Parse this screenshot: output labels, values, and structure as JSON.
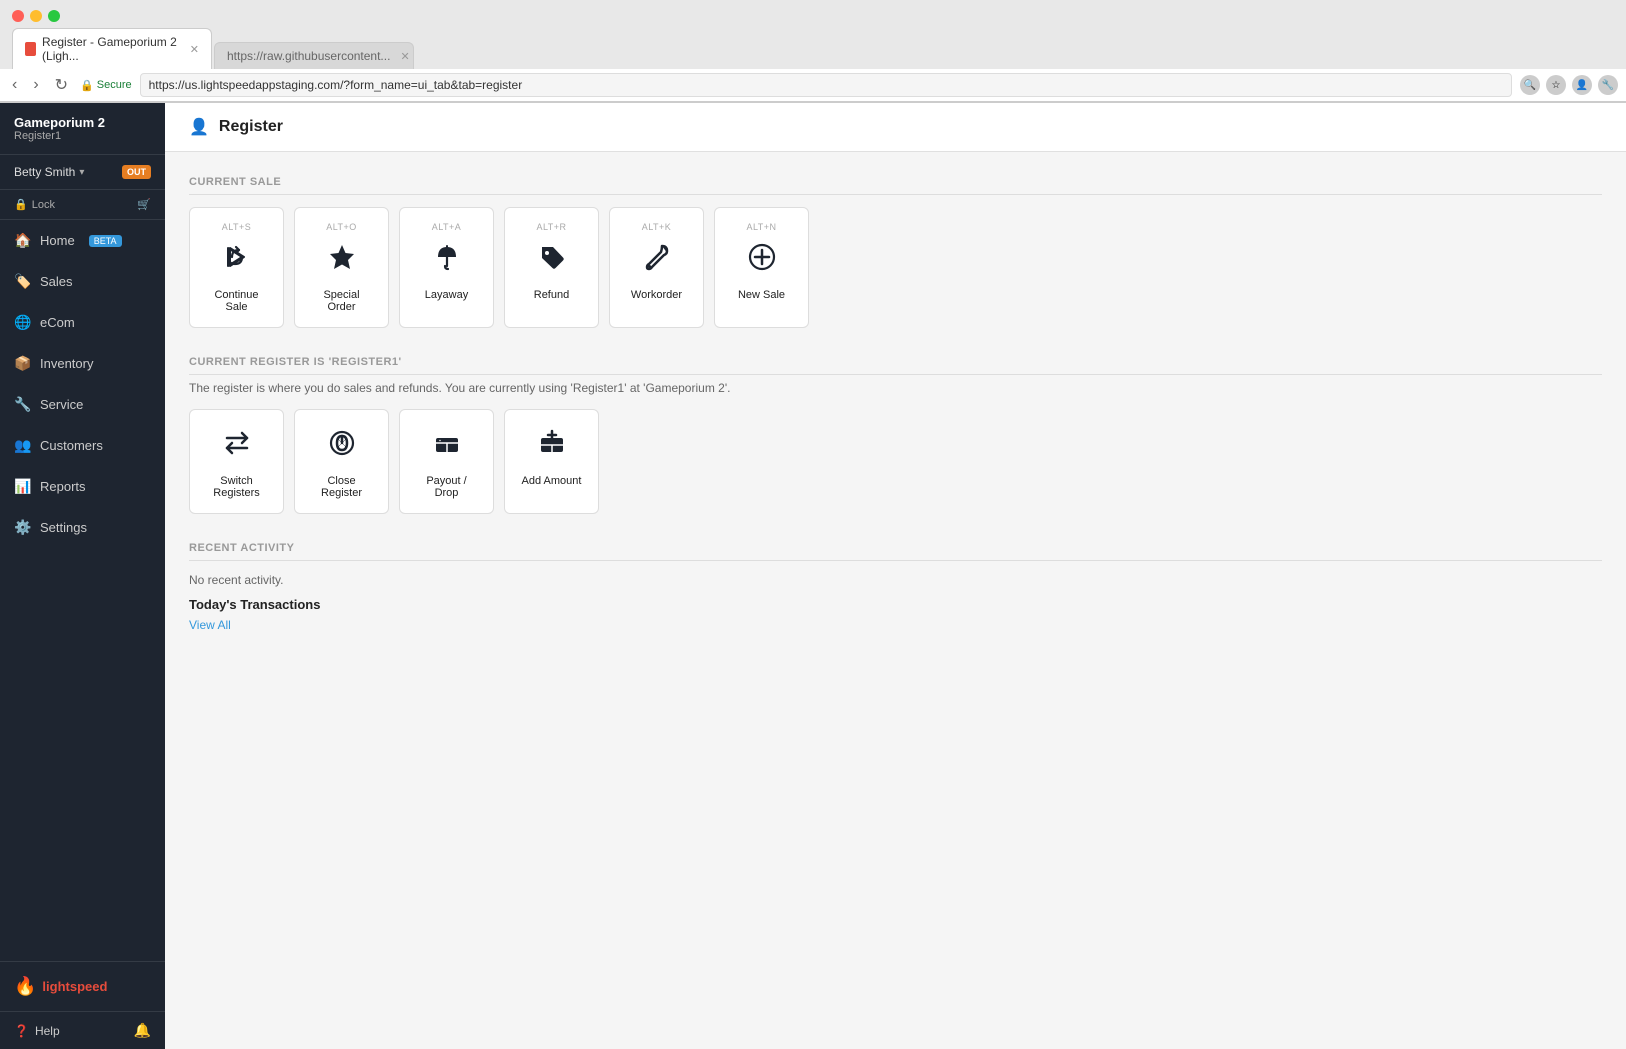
{
  "browser": {
    "tabs": [
      {
        "id": "tab1",
        "label": "Register - Gameporium 2 (Ligh...",
        "active": true,
        "favicon": true
      },
      {
        "id": "tab2",
        "label": "https://raw.githubusercontent...",
        "active": false,
        "favicon": false
      }
    ],
    "url": "https://us.lightspeedappstaging.com/?form_name=ui_tab&tab=register",
    "secure_label": "Secure"
  },
  "sidebar": {
    "store_name": "Gameporium 2",
    "register": "Register1",
    "user_name": "Betty Smith",
    "user_badge": "OUT",
    "quick_actions": [
      {
        "id": "lock",
        "label": "Lock",
        "icon": "🔒"
      },
      {
        "id": "cart",
        "icon": "🛒"
      }
    ],
    "nav_items": [
      {
        "id": "home",
        "label": "Home",
        "icon": "home",
        "badge": "BETA"
      },
      {
        "id": "sales",
        "label": "Sales",
        "icon": "tag"
      },
      {
        "id": "ecom",
        "label": "eCom",
        "icon": "globe"
      },
      {
        "id": "inventory",
        "label": "Inventory",
        "icon": "box"
      },
      {
        "id": "service",
        "label": "Service",
        "icon": "wrench"
      },
      {
        "id": "customers",
        "label": "Customers",
        "icon": "users"
      },
      {
        "id": "reports",
        "label": "Reports",
        "icon": "chart"
      },
      {
        "id": "settings",
        "label": "Settings",
        "icon": "gear"
      }
    ],
    "logo_text": "lightspeed",
    "help_label": "Help"
  },
  "page": {
    "title": "Register",
    "current_sale_section": "CURRENT SALE",
    "current_register_section": "CURRENT REGISTER IS 'REGISTER1'",
    "register_info_text": "The register is where you do sales and refunds. You are currently using 'Register1' at 'Gameporium 2'.",
    "recent_activity_section": "RECENT ACTIVITY",
    "no_activity_text": "No recent activity.",
    "transactions_heading": "Today's Transactions",
    "view_all_label": "View All"
  },
  "current_sale_actions": [
    {
      "id": "continue-sale",
      "shortcut": "ALT+S",
      "label": "Continue Sale"
    },
    {
      "id": "special-order",
      "shortcut": "ALT+O",
      "label": "Special Order"
    },
    {
      "id": "layaway",
      "shortcut": "ALT+A",
      "label": "Layaway"
    },
    {
      "id": "refund",
      "shortcut": "ALT+R",
      "label": "Refund"
    },
    {
      "id": "workorder",
      "shortcut": "ALT+K",
      "label": "Workorder"
    },
    {
      "id": "new-sale",
      "shortcut": "ALT+N",
      "label": "New Sale"
    }
  ],
  "register_actions": [
    {
      "id": "switch-registers",
      "label": "Switch Registers"
    },
    {
      "id": "close-register",
      "label": "Close Register"
    },
    {
      "id": "payout-drop",
      "label": "Payout / Drop"
    },
    {
      "id": "add-amount",
      "label": "Add Amount"
    }
  ]
}
